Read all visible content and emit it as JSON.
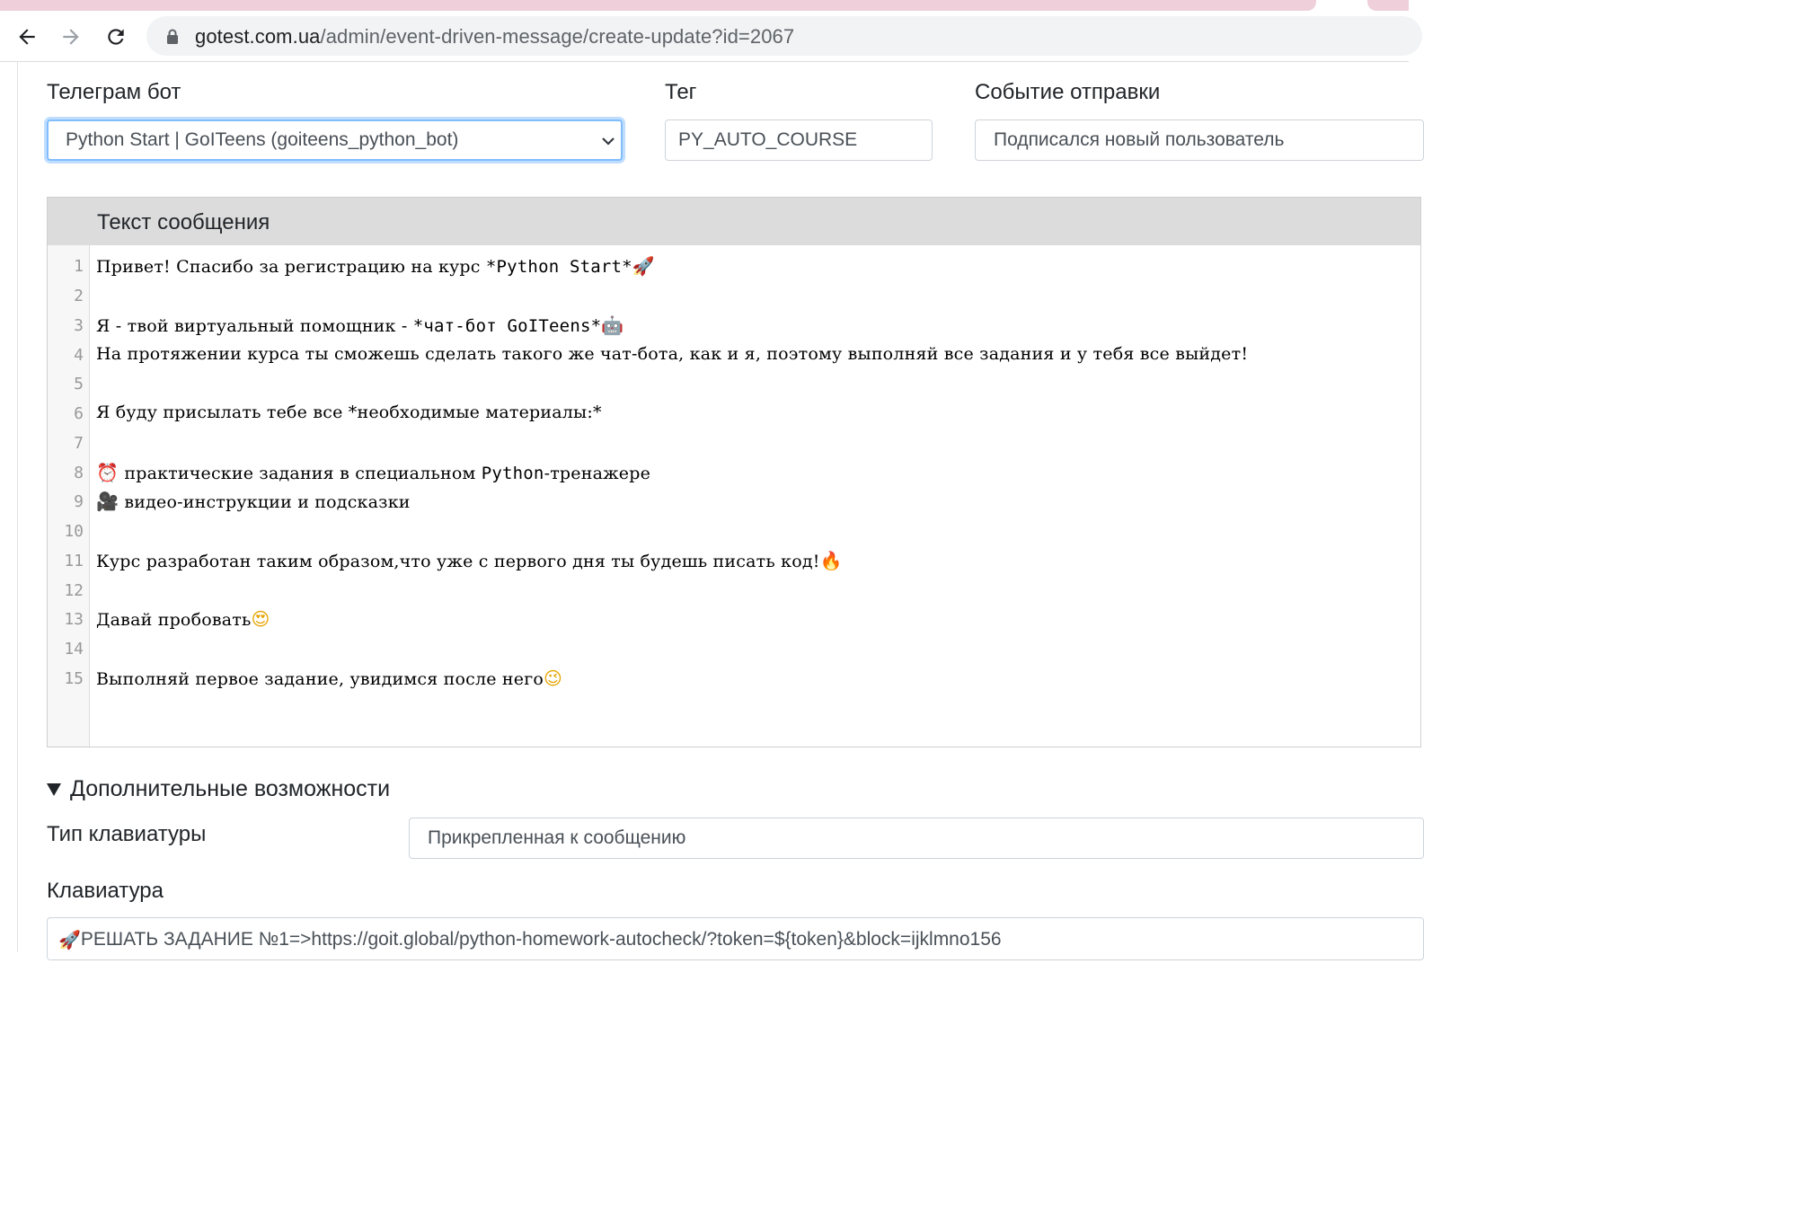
{
  "browser": {
    "url_host": "gotest.com.ua",
    "url_path": "/admin/event-driven-message/create-update?id=2067"
  },
  "form": {
    "bot_label": "Телеграм бот",
    "bot_value": "Python Start | GoITeens (goiteens_python_bot)",
    "tag_label": "Тег",
    "tag_value": "PY_AUTO_COURSE",
    "event_label": "Событие отправки",
    "event_value": "Подписался новый пользователь"
  },
  "editor": {
    "title": "Текст сообщения",
    "line_numbers": [
      "1",
      "2",
      "3",
      "4",
      "5",
      "6",
      "7",
      "8",
      "9",
      "10",
      "11",
      "12",
      "13",
      "14",
      "15"
    ],
    "lines": {
      "l1_text": "Привет! Спасибо за регистрацию на курс ",
      "l1_code": "*Python Start*",
      "l1_emoji": "🚀",
      "l3_text": "Я - твой виртуальный помощник - ",
      "l3_code": "*чат-бот GoITeens*",
      "l3_emoji": "🤖",
      "l4_text": "На протяжении курса ты сможешь сделать такого же чат-бота, как и я, поэтому выполняй все задания и у тебя все выйдет!",
      "l6_text": "Я буду присылать тебе все *необходимые материалы:*",
      "l8_emoji": "⏰",
      "l8_text": " практические задания в специальном ",
      "l8_code": "Python",
      "l8_text2": "-тренажере",
      "l9_emoji": "🎥",
      "l9_text": " видео-инструкции и подсказки",
      "l11_text": "Курс разработан таким образом,что уже с первого дня ты будешь писать код!",
      "l11_emoji": "🔥",
      "l13_text": "Давай пробовать",
      "l13_emoji": "😍",
      "l15_text": "Выполняй первое задание, увидимся после него",
      "l15_emoji": "😉"
    }
  },
  "extra": {
    "summary": "Дополнительные возможности",
    "keyboard_type_label": "Тип клавиатуры",
    "keyboard_type_value": "Прикрепленная к сообщению",
    "keyboard_label": "Клавиатура",
    "keyboard_value_emoji": "🚀",
    "keyboard_value": "РЕШАТЬ ЗАДАНИЕ №1=>https://goit.global/python-homework-autocheck/?token=${token}&block=ijklmno156"
  }
}
